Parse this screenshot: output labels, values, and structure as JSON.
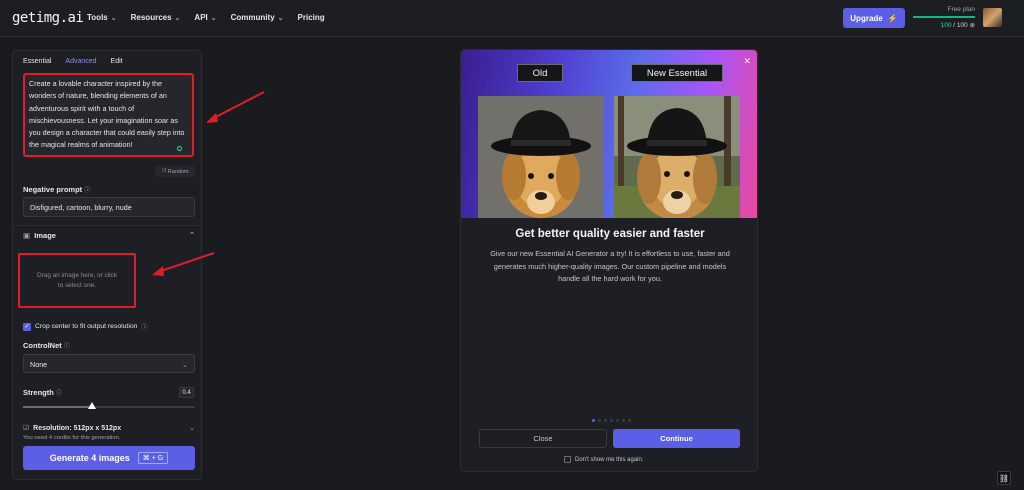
{
  "brand": {
    "logo": "getimg.ai"
  },
  "nav": {
    "items": [
      {
        "label": "Tools",
        "dropdown": true
      },
      {
        "label": "Resources",
        "dropdown": true
      },
      {
        "label": "API",
        "dropdown": true
      },
      {
        "label": "Community",
        "dropdown": true
      },
      {
        "label": "Pricing",
        "dropdown": false
      }
    ],
    "upgrade_label": "Upgrade",
    "plan_name": "Free plan",
    "credits_used": "100",
    "credits_total": "/ 100"
  },
  "panel": {
    "tabs": [
      "Essential",
      "Advanced",
      "Edit"
    ],
    "active_tab": "Advanced",
    "prompt": "Create a lovable character inspired by the wonders of nature, blending elements of an adventurous spirit with a touch of mischievousness. Let your imagination soar as you design a character that could easily step into the magical realms of animation!",
    "random_label": "Random",
    "negative_prompt_label": "Negative prompt",
    "negative_prompt_value": "Disfigured, cartoon, blurry, nude",
    "image_label": "Image",
    "dropzone_text": "Drag an image here, or click to select one.",
    "crop_label": "Crop center to fit output resolution",
    "crop_checked": true,
    "controlnet_label": "ControlNet",
    "controlnet_value": "None",
    "strength_label": "Strength",
    "strength_value": "0.4",
    "strength_fraction": 0.4,
    "resolution_label": "Resolution: 512px x 512px",
    "credits_note": "You need 4 credits for this generation.",
    "generate_label": "Generate 4 images",
    "generate_shortcut": "⌘ + G"
  },
  "modal": {
    "tag_old": "Old",
    "tag_new": "New Essential",
    "title": "Get better quality easier and faster",
    "description": "Give our new Essential AI Generator a try! It is effortless to use, faster and generates much higher-quality images. Our custom pipeline and models handle all the hard work for you.",
    "close_label": "Close",
    "continue_label": "Continue",
    "dont_show_label": "Don't show me this again.",
    "carousel_pages": 7,
    "carousel_active": 0
  },
  "colors": {
    "accent": "#5b5fe6",
    "highlight_annotation": "#e11d2a",
    "background": "#1a1b1f"
  }
}
